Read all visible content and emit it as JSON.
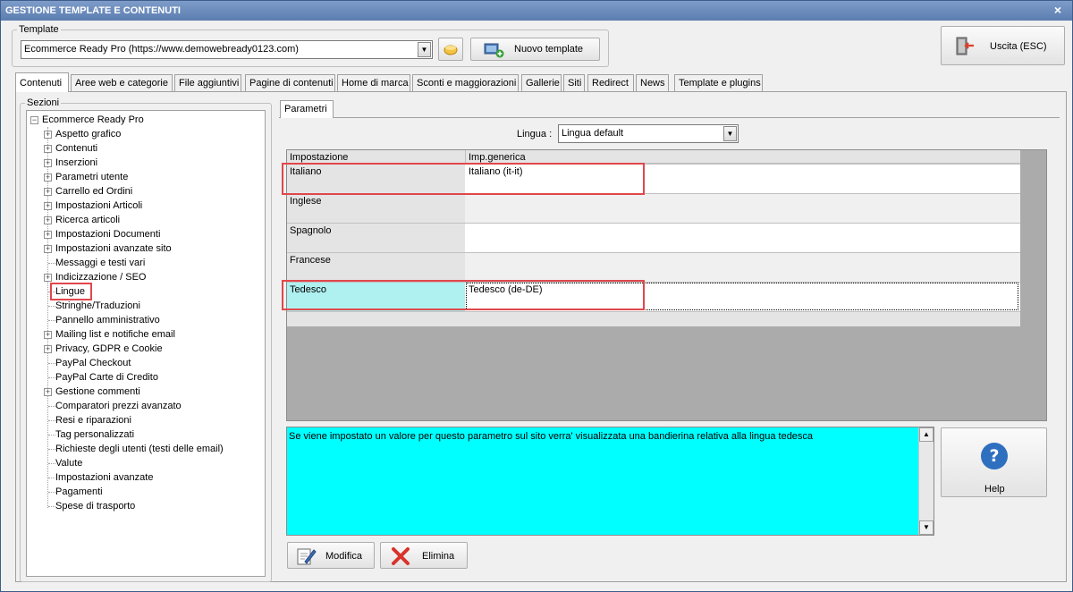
{
  "window": {
    "title": "GESTIONE TEMPLATE E CONTENUTI",
    "close_glyph": "×"
  },
  "template": {
    "group_label": "Template",
    "selected": "Ecommerce Ready Pro (https://www.demowebready0123.com)",
    "new_button": "Nuovo template"
  },
  "exit_button": "Uscita (ESC)",
  "tabs": [
    {
      "label": "Contenuti",
      "active": true
    },
    {
      "label": "Aree web e categorie"
    },
    {
      "label": "File aggiuntivi"
    },
    {
      "label": "Pagine di contenuti"
    },
    {
      "label": "Home di marca"
    },
    {
      "label": "Sconti e maggiorazioni"
    },
    {
      "label": "Gallerie"
    },
    {
      "label": "Siti"
    },
    {
      "label": "Redirect"
    },
    {
      "label": "News"
    },
    {
      "label": "Template e plugins"
    }
  ],
  "sections": {
    "group_label": "Sezioni",
    "root": "Ecommerce Ready Pro",
    "items": [
      {
        "label": "Aspetto grafico",
        "expandable": true
      },
      {
        "label": "Contenuti",
        "expandable": true
      },
      {
        "label": "Inserzioni",
        "expandable": true
      },
      {
        "label": "Parametri utente",
        "expandable": true
      },
      {
        "label": "Carrello ed Ordini",
        "expandable": true
      },
      {
        "label": "Impostazioni Articoli",
        "expandable": true
      },
      {
        "label": "Ricerca articoli",
        "expandable": true
      },
      {
        "label": "Impostazioni Documenti",
        "expandable": true
      },
      {
        "label": "Impostazioni avanzate sito",
        "expandable": true
      },
      {
        "label": "Messaggi e testi vari",
        "expandable": false
      },
      {
        "label": "Indicizzazione / SEO",
        "expandable": true
      },
      {
        "label": "Lingue",
        "expandable": false,
        "selected": true
      },
      {
        "label": "Stringhe/Traduzioni",
        "expandable": false
      },
      {
        "label": "Pannello amministrativo",
        "expandable": false
      },
      {
        "label": "Mailing list e notifiche email",
        "expandable": true
      },
      {
        "label": "Privacy, GDPR e Cookie",
        "expandable": true
      },
      {
        "label": "PayPal Checkout",
        "expandable": false
      },
      {
        "label": "PayPal Carte di Credito",
        "expandable": false
      },
      {
        "label": "Gestione commenti",
        "expandable": true
      },
      {
        "label": "Comparatori prezzi avanzato",
        "expandable": false
      },
      {
        "label": "Resi e riparazioni",
        "expandable": false
      },
      {
        "label": "Tag personalizzati",
        "expandable": false
      },
      {
        "label": "Richieste degli utenti (testi delle email)",
        "expandable": false
      },
      {
        "label": "Valute",
        "expandable": false
      },
      {
        "label": "Impostazioni avanzate",
        "expandable": false
      },
      {
        "label": "Pagamenti",
        "expandable": false
      },
      {
        "label": "Spese di trasporto",
        "expandable": false
      }
    ]
  },
  "params": {
    "tab_label": "Parametri",
    "lingua_label": "Lingua :",
    "lingua_value": "Lingua default",
    "columns": [
      "Impostazione",
      "Imp.generica"
    ],
    "rows": [
      {
        "setting": "Italiano",
        "value": "Italiano (it-it)"
      },
      {
        "setting": "Inglese",
        "value": ""
      },
      {
        "setting": "Spagnolo",
        "value": ""
      },
      {
        "setting": "Francese",
        "value": ""
      },
      {
        "setting": "Tedesco",
        "value": "Tedesco (de-DE)",
        "selected": true
      }
    ],
    "description": "Se viene impostato un valore per questo parametro sul sito verra' visualizzata una bandierina relativa alla lingua tedesca"
  },
  "buttons": {
    "help": "Help",
    "modify": "Modifica",
    "delete": "Elimina"
  },
  "colors": {
    "highlight_red": "#e0474c",
    "selected_row": "#aff0f0",
    "help_bg": "#00ffff"
  }
}
